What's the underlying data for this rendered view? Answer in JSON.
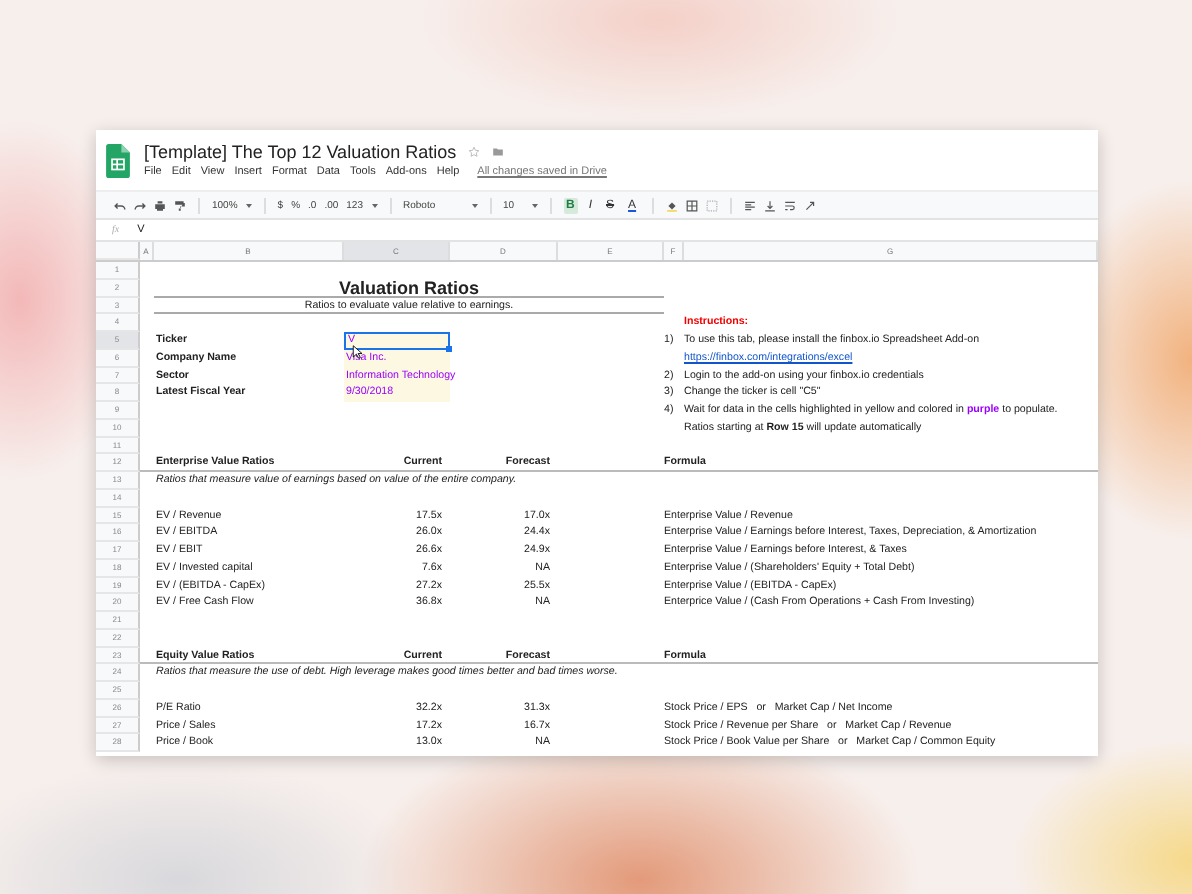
{
  "doc": {
    "title": "[Template] The Top 12 Valuation Ratios",
    "menu": [
      "File",
      "Edit",
      "View",
      "Insert",
      "Format",
      "Data",
      "Tools",
      "Add-ons",
      "Help"
    ],
    "save_status": "All changes saved in Drive"
  },
  "toolbar": {
    "zoom": "100%",
    "currency": "$",
    "percent": "%",
    "decimal_less": ".0",
    "decimal_more": ".00",
    "number_format": "123",
    "font": "Roboto",
    "font_size": "10",
    "format_buttons": [
      {
        "label": "B",
        "kind": "bold",
        "active": true
      },
      {
        "label": "I",
        "kind": "italic",
        "active": false
      },
      {
        "label": "S",
        "kind": "strike",
        "active": false
      },
      {
        "label": "A",
        "kind": "color",
        "active": false
      }
    ]
  },
  "formula_bar": {
    "fx": "fx",
    "value": "V"
  },
  "columns": [
    {
      "label": "A",
      "selected": false
    },
    {
      "label": "B",
      "selected": false
    },
    {
      "label": "C",
      "selected": true
    },
    {
      "label": "D",
      "selected": false
    },
    {
      "label": "E",
      "selected": false
    },
    {
      "label": "F",
      "selected": false
    },
    {
      "label": "G",
      "selected": false
    }
  ],
  "rows": [
    {
      "num": "1",
      "kind": "blank"
    },
    {
      "num": "2",
      "kind": "title",
      "text": "Valuation Ratios"
    },
    {
      "num": "3",
      "kind": "subtitle",
      "text": "Ratios to evaluate value relative to earnings."
    },
    {
      "num": "4",
      "kind": "blank",
      "instruction_title": "Instructions:"
    },
    {
      "num": "5",
      "kind": "field",
      "label": "Ticker",
      "value": {
        "text": "V",
        "selected": true
      },
      "step": "1)",
      "instruction": "To use this tab, please install the finbox.io Spreadsheet Add-on"
    },
    {
      "num": "6",
      "kind": "field",
      "label": "Company Name",
      "value": {
        "text": "Visa Inc.",
        "selected": false
      },
      "link": "https://finbox.com/integrations/excel"
    },
    {
      "num": "7",
      "kind": "field",
      "label": "Sector",
      "value": {
        "text": "Information Technology",
        "selected": false
      },
      "step": "2)",
      "instruction": "Login to the add-on using your finbox.io credentials"
    },
    {
      "num": "8",
      "kind": "field",
      "label": "Latest Fiscal Year",
      "value": {
        "text": "9/30/2018",
        "selected": false
      },
      "step": "3)",
      "instruction": "Change the ticker is cell \"C5\""
    },
    {
      "num": "9",
      "kind": "blank",
      "step": "4)",
      "instruction_parts": [
        {
          "text": "Wait for data in the cells highlighted in yellow and colored in "
        },
        {
          "text": "purple",
          "color": "#9900ff"
        },
        {
          "text": " to populate."
        }
      ]
    },
    {
      "num": "10",
      "kind": "blank",
      "instruction": "Ratios starting at **Row 15** will update automatically"
    },
    {
      "num": "11",
      "kind": "blank"
    },
    {
      "num": "12",
      "kind": "header",
      "name": "Enterprise Value Ratios",
      "current": "Current",
      "forecast": "Forecast",
      "formula": "Formula"
    },
    {
      "num": "13",
      "kind": "note",
      "text": "Ratios that measure value of earnings based on value of the entire company."
    },
    {
      "num": "14",
      "kind": "blank"
    },
    {
      "num": "15",
      "kind": "data",
      "name": "EV / Revenue",
      "current": "17.5x",
      "forecast": "17.0x",
      "formula": "Enterprise Value / Revenue"
    },
    {
      "num": "16",
      "kind": "data",
      "name": "EV / EBITDA",
      "current": "26.0x",
      "forecast": "24.4x",
      "formula": "Enterprise Value / Earnings before Interest, Taxes, Depreciation, & Amortization"
    },
    {
      "num": "17",
      "kind": "data",
      "name": "EV / EBIT",
      "current": "26.6x",
      "forecast": "24.9x",
      "formula": "Enterprise Value / Earnings before Interest, & Taxes"
    },
    {
      "num": "18",
      "kind": "data",
      "name": "EV / Invested capital",
      "current": "7.6x",
      "forecast": "NA",
      "formula": "Enterprise Value / (Shareholders' Equity + Total Debt)"
    },
    {
      "num": "19",
      "kind": "data",
      "name": "EV / (EBITDA - CapEx)",
      "current": "27.2x",
      "forecast": "25.5x",
      "formula": "Enterprise Value / (EBITDA - CapEx)"
    },
    {
      "num": "20",
      "kind": "data",
      "name": "EV / Free Cash Flow",
      "current": "36.8x",
      "forecast": "NA",
      "formula": "Enterprice Value / (Cash From Operations + Cash From Investing)"
    },
    {
      "num": "21",
      "kind": "blank"
    },
    {
      "num": "22",
      "kind": "blank"
    },
    {
      "num": "23",
      "kind": "header",
      "name": "Equity Value Ratios",
      "current": "Current",
      "forecast": "Forecast",
      "formula": "Formula"
    },
    {
      "num": "24",
      "kind": "note",
      "text": "Ratios that measure the use of debt. High leverage makes good times better and bad times worse."
    },
    {
      "num": "25",
      "kind": "blank"
    },
    {
      "num": "26",
      "kind": "data",
      "name": "P/E Ratio",
      "current": "32.2x",
      "forecast": "31.3x",
      "formula": "Stock Price / EPS   or   Market Cap / Net Income"
    },
    {
      "num": "27",
      "kind": "data",
      "name": "Price / Sales",
      "current": "17.2x",
      "forecast": "16.7x",
      "formula": "Stock Price / Revenue per Share   or   Market Cap / Revenue"
    },
    {
      "num": "28",
      "kind": "data",
      "name": "Price / Book",
      "current": "13.0x",
      "forecast": "NA",
      "formula": "Stock Price / Book Value per Share   or   Market Cap / Common Equity"
    }
  ]
}
